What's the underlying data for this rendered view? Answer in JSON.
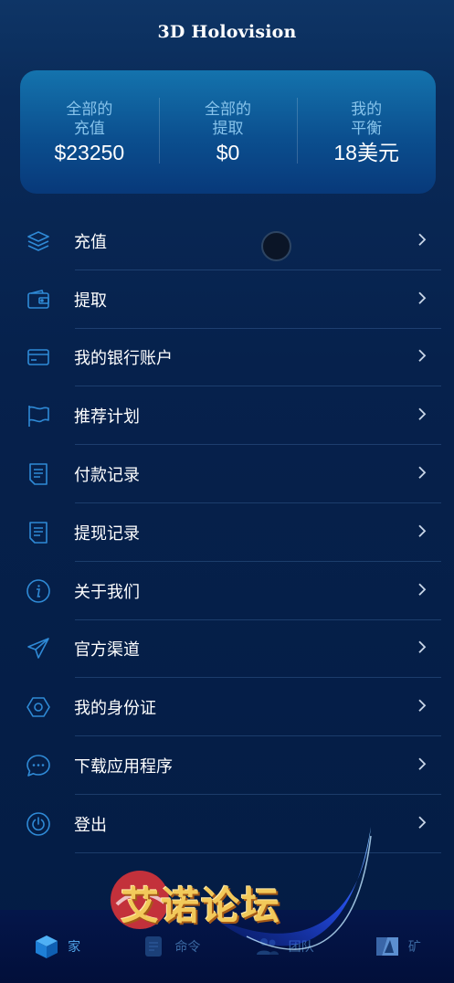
{
  "header": {
    "title": "3D Holovision"
  },
  "stats": [
    {
      "label_line1": "全部的",
      "label_line2": "充值",
      "value": "$23250"
    },
    {
      "label_line1": "全部的",
      "label_line2": "提取",
      "value": "$0"
    },
    {
      "label_line1": "我的",
      "label_line2": "平衡",
      "value": "18美元"
    }
  ],
  "menu": [
    {
      "label": "充值",
      "icon": "layers-icon"
    },
    {
      "label": "提取",
      "icon": "wallet-icon"
    },
    {
      "label": "我的银行账户",
      "icon": "bank-card-icon"
    },
    {
      "label": "推荐计划",
      "icon": "flag-icon"
    },
    {
      "label": "付款记录",
      "icon": "document-icon"
    },
    {
      "label": "提现记录",
      "icon": "document-icon"
    },
    {
      "label": "关于我们",
      "icon": "info-icon"
    },
    {
      "label": "官方渠道",
      "icon": "send-icon"
    },
    {
      "label": "我的身份证",
      "icon": "hexagon-icon"
    },
    {
      "label": "下载应用程序",
      "icon": "chat-icon"
    },
    {
      "label": "登出",
      "icon": "power-icon"
    }
  ],
  "watermark": {
    "text": "艾诺论坛"
  },
  "bottom_nav": [
    {
      "label": "家",
      "icon": "cube-icon",
      "active": true
    },
    {
      "label": "命令",
      "icon": "order-icon",
      "active": false
    },
    {
      "label": "团队",
      "icon": "team-icon",
      "active": false
    },
    {
      "label": "矿",
      "icon": "mine-icon",
      "active": false
    }
  ],
  "colors": {
    "accent": "#3a8fd8",
    "icon": "#2f8ad6",
    "card_top": "#1473ad",
    "card_bottom": "#08397a",
    "stat_label": "#87c3eb",
    "background": "#041c44"
  }
}
